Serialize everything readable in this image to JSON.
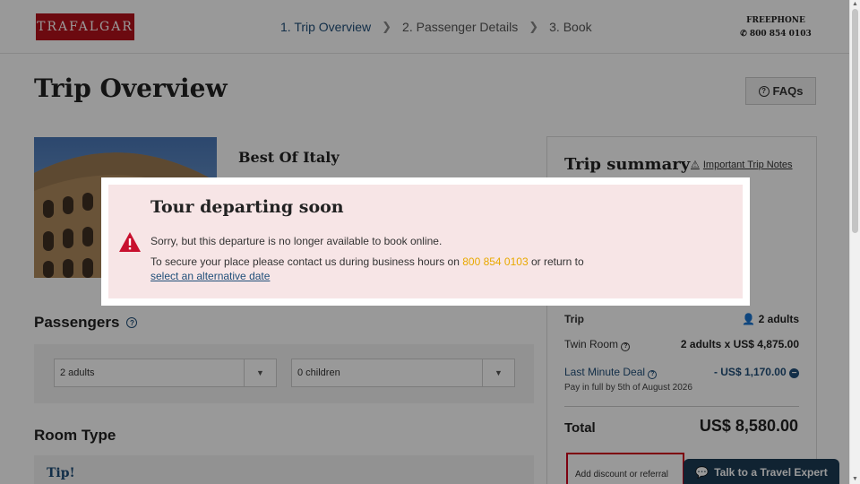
{
  "header": {
    "logo_text": "TRAFALGAR",
    "steps": [
      {
        "label": "1. Trip Overview"
      },
      {
        "label": "2. Passenger Details"
      },
      {
        "label": "3. Book"
      }
    ],
    "freephone_label": "FREEPHONE",
    "freephone_number": "800 854 0103"
  },
  "page": {
    "title": "Trip Overview",
    "faq_label": "FAQs"
  },
  "trip": {
    "name": "Best Of Italy"
  },
  "passengers": {
    "title": "Passengers",
    "adults_value": "2 adults",
    "children_value": "0 children"
  },
  "room_type": {
    "title": "Room Type",
    "tip_label": "Tip!"
  },
  "summary": {
    "title": "Trip summary",
    "notes_link": "Important Trip Notes",
    "trip_label": "Trip",
    "trip_value": "2 adults",
    "room_label": "Twin Room",
    "room_value": "2 adults x US$ 4,875.00",
    "deal_label": "Last Minute Deal",
    "deal_value": "- US$ 1,170.00",
    "deal_note": "Pay in full by 5th of August 2026",
    "total_label": "Total",
    "total_value": "US$ 8,580.00",
    "discount_label": "Add discount or referral"
  },
  "chat": {
    "label": "Talk to a Travel Expert"
  },
  "modal": {
    "title": "Tour departing soon",
    "message_line1": "Sorry, but this departure is no longer available to book online.",
    "message_line2_prefix": "To secure your place please contact us during business hours on",
    "phone": "800 854 0103",
    "message_line2_suffix": "or return to",
    "link_label": "select an alternative date"
  },
  "colors": {
    "brand_red": "#b5121b",
    "navy": "#1c3b54",
    "link_blue": "#1f4e79",
    "phone_gold": "#e8a900",
    "modal_bg": "#f7e5e6",
    "highlight_red": "#d0021b"
  }
}
